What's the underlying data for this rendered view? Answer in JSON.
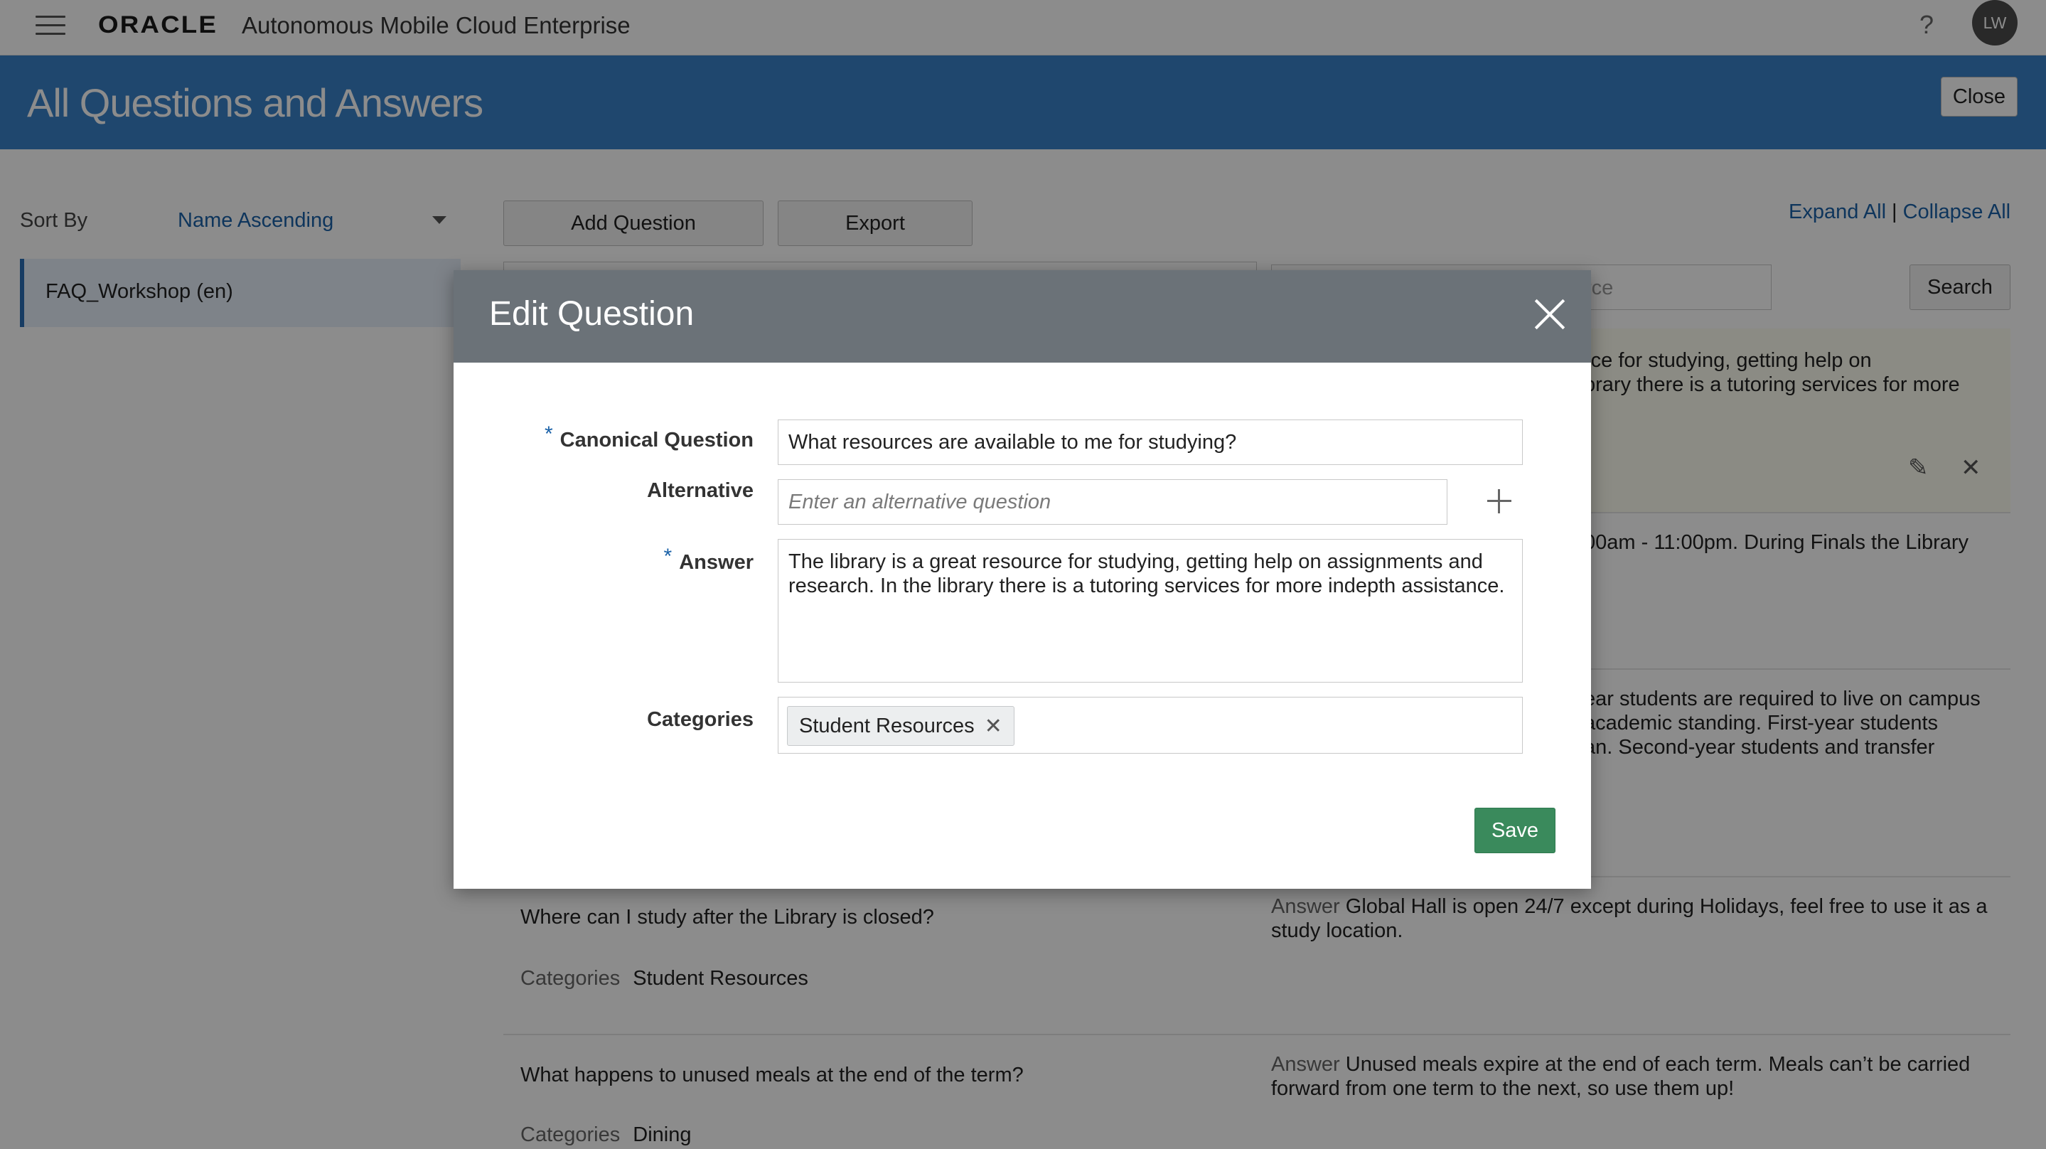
{
  "header": {
    "logo": "ORACLE",
    "app_name": "Autonomous Mobile Cloud Enterprise",
    "help": "?",
    "avatar": "LW"
  },
  "page": {
    "title": "All Questions and Answers",
    "close_label": "Close"
  },
  "sidebar": {
    "sort_label": "Sort By",
    "sort_value": "Name Ascending",
    "items": [
      {
        "label": "FAQ_Workshop (en)"
      }
    ]
  },
  "toolbar": {
    "add_question": "Add Question",
    "export": "Export",
    "expand_all": "Expand All",
    "separator": "|",
    "collapse_all": "Collapse All",
    "search_placeholder_fragment": "rce",
    "search_button": "Search"
  },
  "rows_visible_fragments": [
    {
      "answer": "rce for studying, getting help on\nbrary there is a tutoring services for more"
    },
    {
      "answer": "00am - 11:00pm. During Finals the Library"
    },
    {
      "answer": "ear students are required to live on campus\nacademic standing. First-year students\nan. Second-year students and transfer\n."
    }
  ],
  "rows": [
    {
      "question": "Where can I study after the Library is closed?",
      "categories_label": "Categories",
      "category": "Student Resources",
      "answer_label": "Answer",
      "answer": "Global Hall is open 24/7 except during Holidays, feel free to use it as a study location."
    },
    {
      "question": "What happens to unused meals at the end of the term?",
      "categories_label": "Categories",
      "category": "Dining",
      "answer_label": "Answer",
      "answer": "Unused meals expire at the end of each term. Meals can’t be carried forward from one term to the next, so use them up!"
    }
  ],
  "modal": {
    "title": "Edit Question",
    "required_mark": "*",
    "canonical_label": "Canonical Question",
    "canonical_value": "What resources are available to me for studying?",
    "alternative_label": "Alternative",
    "alternative_placeholder": "Enter an alternative question",
    "answer_label": "Answer",
    "answer_value": "The library is a great resource for studying, getting help on assignments and research. In the library there is a tutoring services for more indepth assistance.",
    "categories_label": "Categories",
    "category_chip": "Student Resources",
    "chip_remove": "✕",
    "save_label": "Save"
  }
}
